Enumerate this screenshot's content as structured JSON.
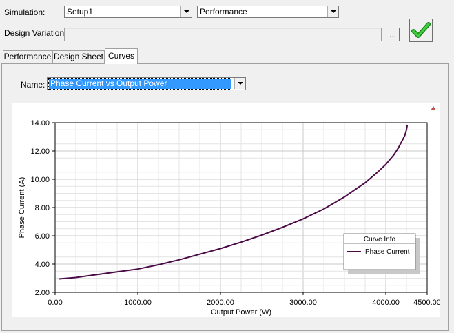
{
  "simulation": {
    "label": "Simulation:",
    "setup_value": "Setup1",
    "type_value": "Performance"
  },
  "design_variation": {
    "label": "Design Variation:",
    "value": "",
    "browse_label": "..."
  },
  "tabs": [
    {
      "label": "Performance"
    },
    {
      "label": "Design Sheet"
    },
    {
      "label": "Curves"
    }
  ],
  "curves": {
    "name_label": "Name:",
    "name_value": "Phase Current vs Output Power"
  },
  "legend": {
    "title": "Curve Info",
    "item": "Phase Current"
  },
  "colors": {
    "curve": "#4b0a46",
    "accent_check": "#2fb52f"
  },
  "chart_data": {
    "type": "line",
    "title": "",
    "xlabel": "Output Power (W)",
    "ylabel": "Phase Current (A)",
    "xlim": [
      0,
      4500
    ],
    "ylim": [
      2,
      14
    ],
    "x_ticks": [
      "0.00",
      "1000.00",
      "2000.00",
      "3000.00",
      "4000.00",
      "4500.00"
    ],
    "y_ticks": [
      "2.00",
      "4.00",
      "6.00",
      "8.00",
      "10.00",
      "12.00",
      "14.00"
    ],
    "grid": true,
    "legend_position": "right",
    "series": [
      {
        "name": "Phase Current",
        "x": [
          50,
          250,
          500,
          750,
          1000,
          1250,
          1500,
          1750,
          2000,
          2250,
          2500,
          2750,
          3000,
          3250,
          3500,
          3750,
          3900,
          4000,
          4100,
          4150,
          4200,
          4230,
          4250,
          4260
        ],
        "y": [
          2.95,
          3.05,
          3.25,
          3.45,
          3.65,
          3.95,
          4.3,
          4.7,
          5.1,
          5.55,
          6.05,
          6.6,
          7.2,
          7.9,
          8.75,
          9.75,
          10.5,
          11.05,
          11.75,
          12.2,
          12.75,
          13.1,
          13.5,
          13.85
        ]
      }
    ]
  }
}
